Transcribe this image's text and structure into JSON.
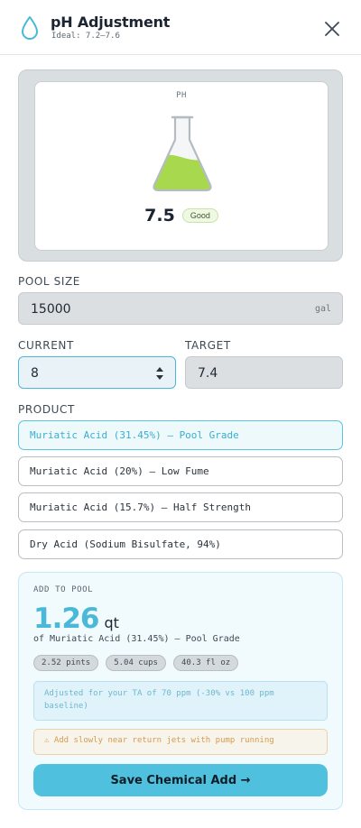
{
  "header": {
    "title": "pH Adjustment",
    "subtitle": "Ideal: 7.2–7.6",
    "icon": "water-drop-icon",
    "close_icon": "close-icon"
  },
  "gauge": {
    "label": "PH",
    "value": "7.5",
    "status": "Good",
    "fill_fraction": 0.45,
    "fill_color": "#a8d84e"
  },
  "pool_size": {
    "label": "POOL SIZE",
    "value": "15000",
    "unit": "gal"
  },
  "current": {
    "label": "CURRENT",
    "value": "8"
  },
  "target": {
    "label": "TARGET",
    "value": "7.4"
  },
  "product": {
    "label": "PRODUCT",
    "options": [
      {
        "label": "Muriatic Acid (31.45%) — Pool Grade",
        "selected": true
      },
      {
        "label": "Muriatic Acid (20%) — Low Fume",
        "selected": false
      },
      {
        "label": "Muriatic Acid (15.7%) — Half Strength",
        "selected": false
      },
      {
        "label": "Dry Acid (Sodium Bisulfate, 94%)",
        "selected": false
      }
    ]
  },
  "result": {
    "label": "ADD TO POOL",
    "amount": "1.26",
    "unit": "qt",
    "of_product": "of Muriatic Acid (31.45%) — Pool Grade",
    "conversions": [
      "2.52 pints",
      "5.04 cups",
      "40.3 fl oz"
    ],
    "info": "Adjusted for your TA of 70 ppm (-30% vs 100 ppm baseline)",
    "warning": "⚠ Add slowly near return jets with pump running",
    "save_label": "Save Chemical Add →"
  },
  "colors": {
    "accent": "#4fc1df",
    "status_good": "#c8e3a8",
    "warning": "#d79a4e"
  }
}
